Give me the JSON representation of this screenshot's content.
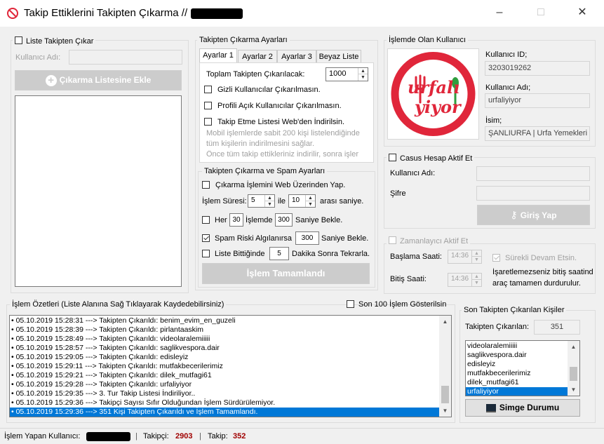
{
  "window": {
    "title": "Takip Ettiklerini Takipten Çıkarma //"
  },
  "left": {
    "list_chk_label": "Liste Takipten Çıkar",
    "username_label": "Kullanıcı Adı:",
    "add_button": "Çıkarma Listesine Ekle"
  },
  "settings": {
    "legend": "Takipten Çıkarma Ayarları",
    "tabs": [
      "Ayarlar 1",
      "Ayarlar 2",
      "Ayarlar 3",
      "Beyaz Liste"
    ],
    "total_label": "Toplam Takipten Çıkarılacak:",
    "total_value": "1000",
    "hidden_label": "Gizli Kullanıcılar Çıkarılmasın.",
    "public_label": "Profili Açık Kullanıcılar Çıkarılmasın.",
    "web_label": "Takip Etme Listesi Web'den İndirilsin.",
    "note1": "Mobil işlemlerde sabit 200 kişi listelendiğinde",
    "note2": "tüm kişilerin indirilmesini sağlar.",
    "note3": "Önce tüm takip ettikleriniz indirilir, sonra işler"
  },
  "spam": {
    "legend": "Takipten Çıkarma ve Spam Ayarları",
    "web_label": "Çıkarma İşlemini Web Üzerinden Yap.",
    "duration_label": "İşlem Süresi:",
    "dur_min": "5",
    "with_label": "ile",
    "dur_max": "10",
    "range_label": "arası saniye.",
    "every_label": "Her",
    "every_value": "30",
    "ops_label": "İşlemde",
    "wait_value": "300",
    "wait_label": "Saniye Bekle.",
    "risk_label": "Spam Riski Algılanırsa",
    "risk_value": "300",
    "risk_wait_label": "Saniye Bekle.",
    "repeat_label": "Liste Bittiğinde",
    "repeat_value": "5",
    "repeat_label2": "Dakika Sonra Tekrarla.",
    "done_button": "İşlem Tamamlandı"
  },
  "current": {
    "legend": "İşlemde Olan Kullanıcı",
    "logo_text1": "urfalı",
    "logo_text2": "yiyor",
    "id_label": "Kullanıcı ID;",
    "id_value": "3203019262",
    "name_label": "Kullanıcı Adı;",
    "name_value": "urfaliyiyor",
    "fullname_label": "İsim;",
    "fullname_value": "ŞANLIURFA | Urfa Yemekleri"
  },
  "spy": {
    "chk_label": "Casus Hesap Aktif Et",
    "user_label": "Kullanıcı Adı:",
    "pass_label": "Şifre",
    "login_button": "Giriş Yap"
  },
  "timer": {
    "chk_label": "Zamanlayıcı Aktif Et",
    "start_label": "Başlama Saati:",
    "start_value": "14:36",
    "end_label": "Bitiş Saati:",
    "end_value": "14:36",
    "cont_label": "Sürekli Devam Etsin.",
    "note1": "İşaretlemezseniz bitiş saatinde",
    "note2": "araç tamamen durdurulur."
  },
  "log": {
    "legend": "İşlem Özetleri (Liste Alanına Sağ Tıklayarak Kaydedebilirsiniz)",
    "last100_label": "Son 100 İşlem Gösterilsin",
    "rows": [
      "• 05.10.2019 15:28:31 ---> Takipten Çıkarıldı: benim_evim_en_guzeli",
      "• 05.10.2019 15:28:39 ---> Takipten Çıkarıldı: pirlantaaskim",
      "• 05.10.2019 15:28:49 ---> Takipten Çıkarıldı: videolaralemiiiii",
      "• 05.10.2019 15:28:57 ---> Takipten Çıkarıldı: saglikvespora.dair",
      "• 05.10.2019 15:29:05 ---> Takipten Çıkarıldı: edisleyiz",
      "• 05.10.2019 15:29:11 ---> Takipten Çıkarıldı: mutfakbecerilerimiz",
      "• 05.10.2019 15:29:21 ---> Takipten Çıkarıldı: dilek_mutfagi61",
      "• 05.10.2019 15:29:28 ---> Takipten Çıkarıldı: urfaliyiyor",
      "• 05.10.2019 15:29:35 ---> 3. Tur Takip Listesi İndiriliyor..",
      "• 05.10.2019 15:29:36 ---> Takipçi Sayısı Sıfır Olduğundan İşlem Sürdürülemiyor.",
      "• 05.10.2019 15:29:36 ---> 351 Kişi Takipten Çıkarıldı ve İşlem Tamamlandı."
    ]
  },
  "recent": {
    "legend": "Son Takipten Çıkarılan Kişiler",
    "count_label": "Takipten Çıkarılan:",
    "count_value": "351",
    "items": [
      "videolaralemiiiii",
      "saglikvespora.dair",
      "edisleyiz",
      "mutfakbecerilerimiz",
      "dilek_mutfagi61",
      "urfaliyiyor"
    ],
    "minimize_button": "Simge Durumu"
  },
  "status": {
    "user_label": "İşlem Yapan Kullanıcı:",
    "followers_label": "Takipçi:",
    "followers_value": "2903",
    "following_label": "Takip:",
    "following_value": "352"
  },
  "colors": {
    "accent": "#0078d7",
    "logo_red": "#e0263a",
    "logo_green": "#2f9e3e",
    "status_red": "#a00000"
  }
}
